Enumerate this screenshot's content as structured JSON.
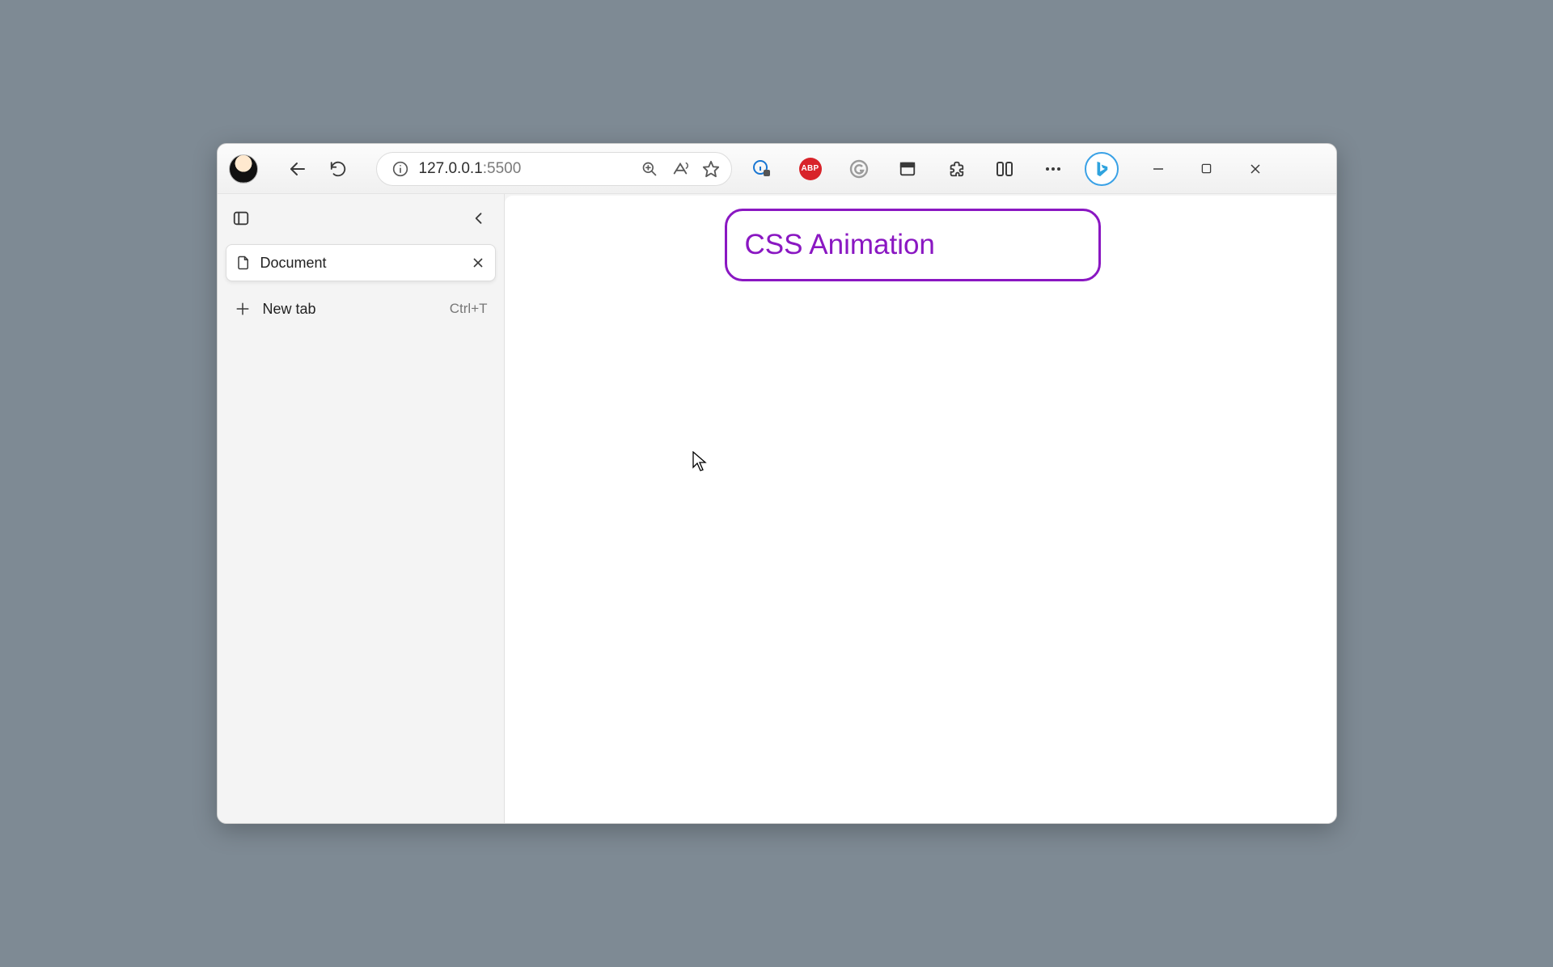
{
  "toolbar": {
    "url_host": "127.0.0.1",
    "url_port": ":5500",
    "abp_label": "ABP"
  },
  "sidebar": {
    "tab_title": "Document",
    "newtab_label": "New tab",
    "newtab_shortcut": "Ctrl+T"
  },
  "page": {
    "heading": "CSS Animation"
  },
  "colors": {
    "accent_purple": "#8a17c2",
    "abp_red": "#d8232a",
    "bing_blue": "#39a1e6"
  }
}
